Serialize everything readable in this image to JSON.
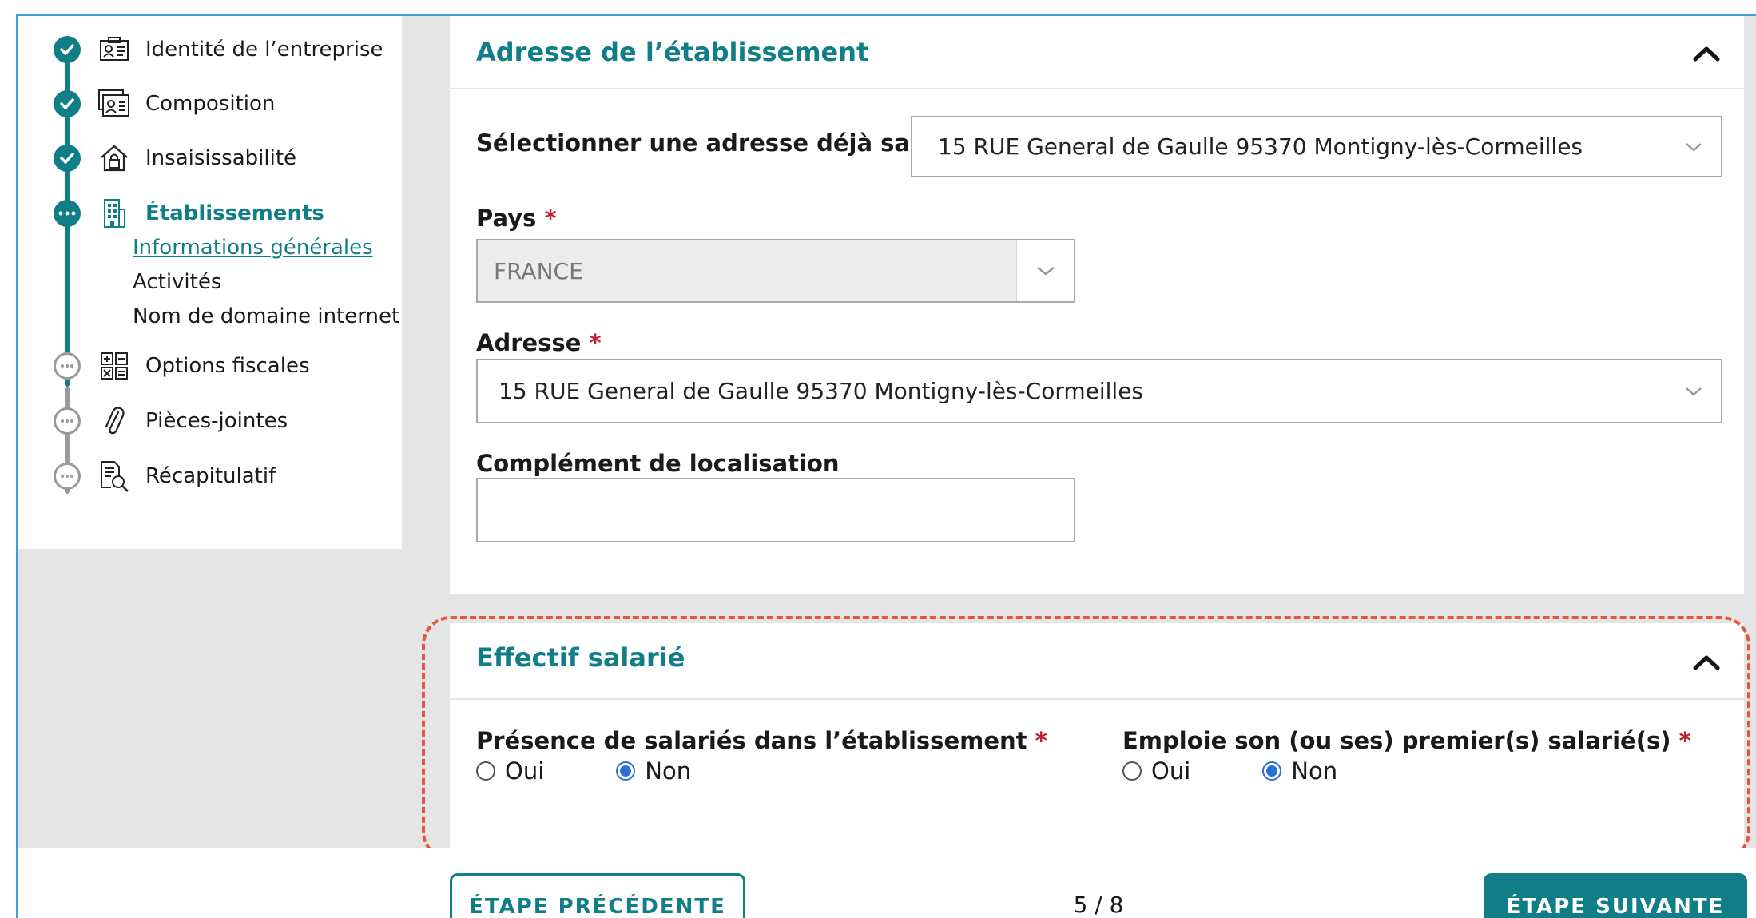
{
  "colors": {
    "accent": "#0f7e87",
    "required": "#c0202b",
    "radio_checked": "#2a6fd6",
    "highlight_dashed": "#e8553e",
    "pending_step": "#9a9a9a"
  },
  "sidebar": {
    "steps": [
      {
        "label": "Identité de l’entreprise",
        "status": "done",
        "icon": "id-card-icon"
      },
      {
        "label": "Composition",
        "status": "done",
        "icon": "people-card-icon"
      },
      {
        "label": "Insaisissabilité",
        "status": "done",
        "icon": "house-lock-icon"
      },
      {
        "label": "Établissements",
        "status": "current",
        "icon": "building-icon"
      },
      {
        "label": "Options fiscales",
        "status": "pending",
        "icon": "calculator-icon"
      },
      {
        "label": "Pièces-jointes",
        "status": "pending",
        "icon": "paperclip-icon"
      },
      {
        "label": "Récapitulatif",
        "status": "pending",
        "icon": "document-search-icon"
      }
    ],
    "substeps": [
      {
        "label": "Informations générales",
        "active": true
      },
      {
        "label": "Activités",
        "active": false
      },
      {
        "label": "Nom de domaine internet",
        "active": false
      }
    ]
  },
  "address_panel": {
    "title": "Adresse de l’établissement",
    "saved_address_label": "Sélectionner une adresse déjà saisie :",
    "saved_address_value": "15 RUE General de Gaulle 95370 Montigny-lès-Cormeilles",
    "country_label": "Pays",
    "country_value": "FRANCE",
    "address_label": "Adresse",
    "address_value": "15 RUE General de Gaulle 95370 Montigny-lès-Cormeilles",
    "complement_label": "Complément de localisation",
    "complement_value": "",
    "required_mark": "*"
  },
  "staff_panel": {
    "title": "Effectif salarié",
    "presence_label": "Présence de salariés dans l’établissement",
    "first_employee_label": "Emploie son (ou ses) premier(s) salarié(s)",
    "required_mark": "*",
    "option_yes": "Oui",
    "option_no": "Non",
    "presence_selected": "Non",
    "first_employee_selected": "Non"
  },
  "footer": {
    "prev_label": "ÉTAPE PRÉCÉDENTE",
    "next_label": "ÉTAPE SUIVANTE",
    "pager": "5 / 8"
  }
}
